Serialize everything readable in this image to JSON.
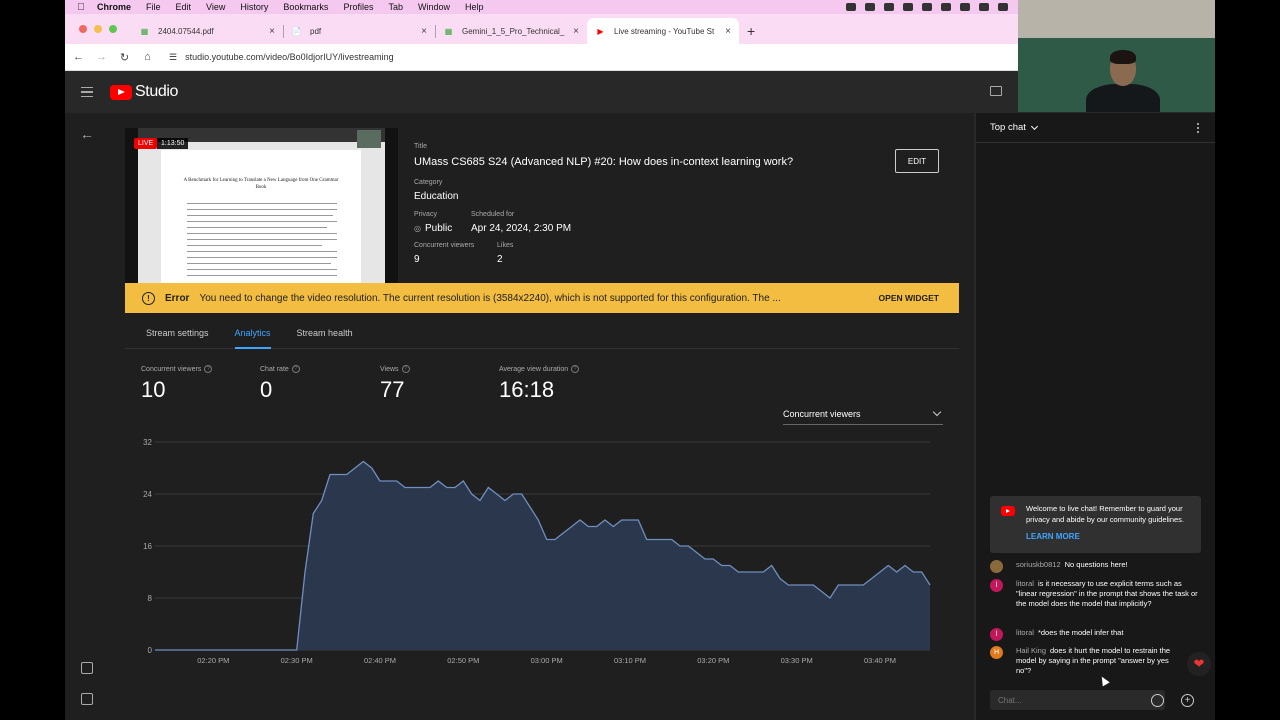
{
  "menubar": {
    "app": "Chrome",
    "items": [
      "File",
      "Edit",
      "View",
      "History",
      "Bookmarks",
      "Profiles",
      "Tab",
      "Window",
      "Help"
    ]
  },
  "browser": {
    "tabs": [
      {
        "title": "2404.07544.pdf",
        "favicon": "green-doc-icon"
      },
      {
        "title": "pdf",
        "favicon": "file-icon"
      },
      {
        "title": "Gemini_1_5_Pro_Technical_",
        "favicon": "green-doc-icon"
      },
      {
        "title": "Live streaming - YouTube St",
        "favicon": "youtube-icon"
      }
    ],
    "url": "studio.youtube.com/video/Bo0IdjorIUY/livestreaming"
  },
  "studio": {
    "logo_text": "Studio"
  },
  "preview": {
    "live_label": "LIVE",
    "elapsed": "1:13:50",
    "paper_title": "A Benchmark for Learning to Translate a New Language from One Grammar Book"
  },
  "stream": {
    "title_label": "Title",
    "title": "UMass CS685 S24 (Advanced NLP) #20: How does in-context learning work?",
    "edit_label": "EDIT",
    "category_label": "Category",
    "category": "Education",
    "privacy_label": "Privacy",
    "privacy": "Public",
    "scheduled_label": "Scheduled for",
    "scheduled": "Apr 24, 2024, 2:30 PM",
    "concurrent_label": "Concurrent viewers",
    "concurrent": "9",
    "likes_label": "Likes",
    "likes": "2"
  },
  "error": {
    "title": "Error",
    "message": "You need to change the video resolution. The current resolution is (3584x2240), which is not supported for this configuration. The ...",
    "action": "OPEN WIDGET",
    "color": "#f2bd41"
  },
  "tabs": [
    "Stream settings",
    "Analytics",
    "Stream health"
  ],
  "active_tab": "Analytics",
  "stats": [
    {
      "label": "Concurrent viewers",
      "value": "10"
    },
    {
      "label": "Chat rate",
      "value": "0"
    },
    {
      "label": "Views",
      "value": "77"
    },
    {
      "label": "Average view duration",
      "value": "16:18"
    }
  ],
  "metric_dropdown": "Concurrent viewers",
  "chart_data": {
    "type": "area",
    "title": "",
    "xlabel": "",
    "ylabel": "",
    "ylim": [
      0,
      32
    ],
    "yticks": [
      0,
      8,
      16,
      24,
      32
    ],
    "xticks": [
      "02:20 PM",
      "02:30 PM",
      "02:40 PM",
      "02:50 PM",
      "03:00 PM",
      "03:10 PM",
      "03:20 PM",
      "03:30 PM",
      "03:40 PM"
    ],
    "x_start": "02:13 PM",
    "x_step_minutes": 1,
    "series": [
      {
        "values": [
          0,
          0,
          0,
          0,
          0,
          0,
          0,
          0,
          0,
          0,
          0,
          0,
          0,
          0,
          0,
          0,
          0,
          0,
          12,
          21,
          23,
          27,
          27,
          27,
          28,
          29,
          28,
          26,
          26,
          26,
          25,
          25,
          25,
          25,
          26,
          25,
          25,
          26,
          24,
          23,
          25,
          24,
          23,
          24,
          24,
          22,
          20,
          17,
          17,
          18,
          19,
          20,
          19,
          19,
          20,
          19,
          20,
          20,
          20,
          17,
          17,
          17,
          17,
          16,
          16,
          15,
          14,
          14,
          13,
          13,
          12,
          12,
          12,
          12,
          13,
          11,
          10,
          10,
          10,
          10,
          9,
          8,
          10,
          10,
          10,
          10,
          11,
          12,
          13,
          12,
          13,
          12,
          12,
          10
        ],
        "color": "#6f8fbf"
      }
    ],
    "grid": true
  },
  "chat": {
    "header": "Top chat",
    "welcome": "Welcome to live chat! Remember to guard your privacy and abide by our community guidelines.",
    "learn_more": "LEARN MORE",
    "messages": [
      {
        "author": "soriuskb0812",
        "text": "No questions here!",
        "avatar": "",
        "avatar_color": "#8a6a3a"
      },
      {
        "author": "litoral",
        "text": "is it necessary to use explicit terms such as \"linear regression\" in the prompt that shows the task or the model does the model that implicitly?",
        "avatar": "l",
        "avatar_color": "#c2185b"
      },
      {
        "author": "litoral",
        "text": "*does the model infer that",
        "avatar": "l",
        "avatar_color": "#c2185b"
      },
      {
        "author": "Hail King",
        "text": "does it hurt the model to restrain the model by saying in the prompt \"answer by yes no\"?",
        "avatar": "H",
        "avatar_color": "#e07a1f"
      }
    ],
    "input_placeholder": "Chat..."
  }
}
